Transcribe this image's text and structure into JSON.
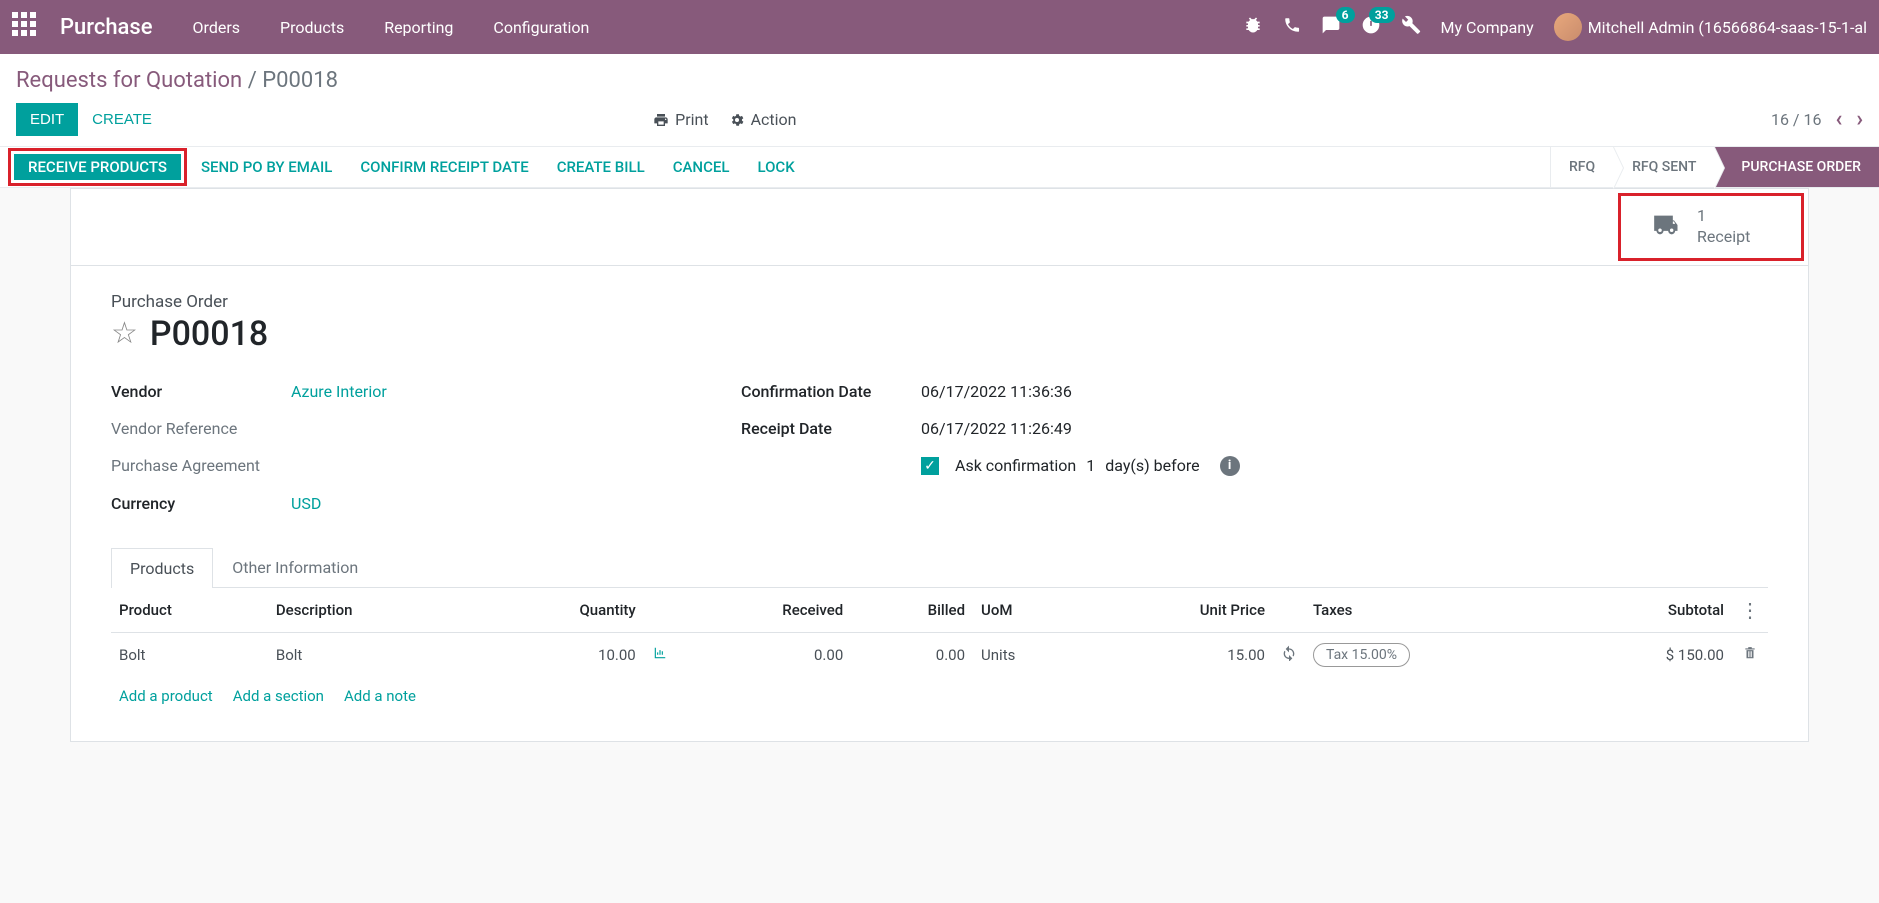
{
  "topbar": {
    "brand": "Purchase",
    "menu": {
      "orders": "Orders",
      "products": "Products",
      "reporting": "Reporting",
      "configuration": "Configuration"
    },
    "messaging_count": "6",
    "activity_count": "33",
    "company": "My Company",
    "user": "Mitchell Admin (16566864-saas-15-1-al"
  },
  "breadcrumb": {
    "parent": "Requests for Quotation",
    "current": "P00018"
  },
  "cp": {
    "edit": "Edit",
    "create": "Create",
    "print": "Print",
    "action": "Action",
    "pager": "16 / 16"
  },
  "statusbar": {
    "receive": "Receive Products",
    "send": "Send PO by Email",
    "confirm_receipt": "Confirm Receipt Date",
    "create_bill": "Create Bill",
    "cancel": "Cancel",
    "lock": "Lock",
    "rfq": "RFQ",
    "rfq_sent": "RFQ Sent",
    "po": "Purchase Order"
  },
  "smart": {
    "count": "1",
    "label": "Receipt"
  },
  "form": {
    "doc_label": "Purchase Order",
    "doc_title": "P00018",
    "vendor_label": "Vendor",
    "vendor": "Azure Interior",
    "vendor_ref_label": "Vendor Reference",
    "agreement_label": "Purchase Agreement",
    "currency_label": "Currency",
    "currency": "USD",
    "conf_date_label": "Confirmation Date",
    "conf_date": "06/17/2022 11:36:36",
    "receipt_date_label": "Receipt Date",
    "receipt_date": "06/17/2022 11:26:49",
    "ask_conf_a": "Ask confirmation",
    "ask_conf_days": "1",
    "ask_conf_b": "day(s) before"
  },
  "tabs": {
    "products": "Products",
    "other": "Other Information"
  },
  "table": {
    "headers": {
      "product": "Product",
      "description": "Description",
      "quantity": "Quantity",
      "received": "Received",
      "billed": "Billed",
      "uom": "UoM",
      "unit_price": "Unit Price",
      "taxes": "Taxes",
      "subtotal": "Subtotal"
    },
    "row": {
      "product": "Bolt",
      "description": "Bolt",
      "quantity": "10.00",
      "received": "0.00",
      "billed": "0.00",
      "uom": "Units",
      "unit_price": "15.00",
      "tax": "Tax 15.00%",
      "subtotal": "$ 150.00"
    },
    "add_product": "Add a product",
    "add_section": "Add a section",
    "add_note": "Add a note"
  }
}
